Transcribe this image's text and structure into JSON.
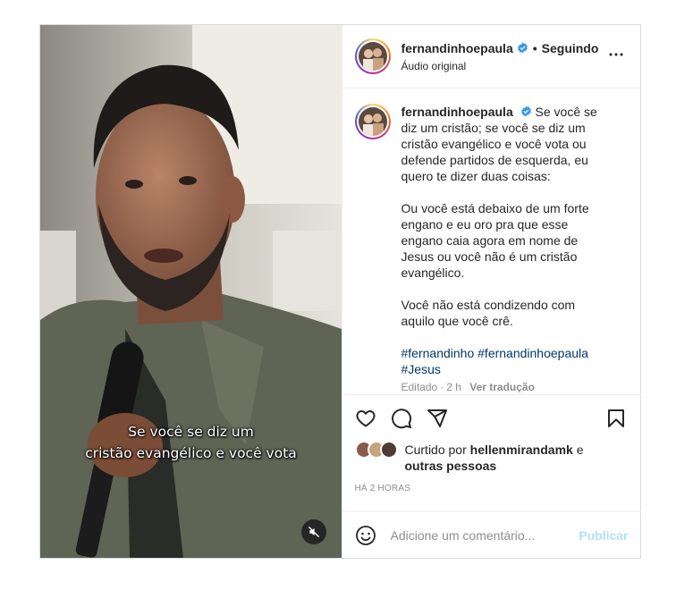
{
  "post": {
    "username": "fernandinhoepaula",
    "follow_status": "Seguindo",
    "audio_label": "Áudio original",
    "subtitles": [
      "Se você se diz um",
      "cristão evangélico e você vota"
    ],
    "caption": {
      "first_line": "Se você se diz um cristão; se você se diz um cristão evangélico e você vota ou defende partidos de esquerda, eu quero te dizer duas coisas:",
      "paragraph_2": "Ou você está debaixo de um forte engano e eu oro pra que esse engano caia agora em nome de Jesus ou você não é um cristão evangélico.",
      "paragraph_3": "Você não está condizendo com aquilo que você crê.",
      "hashtags": [
        "#fernandinho",
        "#fernandinhoepaula",
        "#Jesus"
      ],
      "edited": "Editado",
      "edited_time": "2 h",
      "see_translation": "Ver tradução"
    },
    "likes": {
      "prefix": "Curtido por",
      "user": "hellenmirandamk",
      "connector": "e",
      "others": "outras pessoas"
    },
    "time_ago": "HÁ 2 HORAS",
    "comment": {
      "placeholder": "Adicione um comentário...",
      "publish": "Publicar"
    }
  },
  "icons": {
    "verified": "verified-badge-icon",
    "more": "more-options-icon",
    "like": "heart-icon",
    "comment": "comment-bubble-icon",
    "share": "paper-plane-icon",
    "save": "bookmark-icon",
    "emoji": "emoji-icon",
    "mute": "speaker-muted-icon"
  },
  "colors": {
    "verified_blue": "#3897f0",
    "hashtag_link": "#00376b",
    "publish_disabled": "#b2dffc",
    "muted_text": "#8e8e8e"
  }
}
